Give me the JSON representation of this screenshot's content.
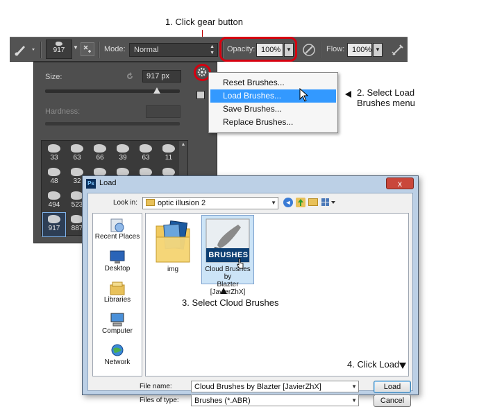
{
  "annotations": {
    "step1": "1. Click gear button",
    "step2_line1": "2. Select Load",
    "step2_line2": "Brushes menu",
    "step3": "3. Select Cloud Brushes",
    "step4": "4. Click Load"
  },
  "toolbar": {
    "brush_size": "917",
    "mode_label": "Mode:",
    "mode_value": "Normal",
    "opacity_label": "Opacity:",
    "opacity_value": "100%",
    "flow_label": "Flow:",
    "flow_value": "100%"
  },
  "brush_panel": {
    "size_label": "Size:",
    "size_value": "917 px",
    "size_level_pct": 83,
    "hardness_label": "Hardness:",
    "brushes": [
      {
        "num": "33"
      },
      {
        "num": "63"
      },
      {
        "num": "66"
      },
      {
        "num": "39"
      },
      {
        "num": "63"
      },
      {
        "num": "11"
      },
      {
        "num": "48"
      },
      {
        "num": "32"
      },
      {
        "num": ""
      },
      {
        "num": ""
      },
      {
        "num": ""
      },
      {
        "num": ""
      },
      {
        "num": "494"
      },
      {
        "num": "523"
      },
      {
        "num": ""
      },
      {
        "num": ""
      },
      {
        "num": ""
      },
      {
        "num": ""
      },
      {
        "num": "917"
      },
      {
        "num": "887"
      },
      {
        "num": ""
      },
      {
        "num": ""
      },
      {
        "num": ""
      },
      {
        "num": ""
      }
    ]
  },
  "menu": {
    "items": [
      "Reset Brushes...",
      "Load Brushes...",
      "Save Brushes...",
      "Replace Brushes..."
    ],
    "highlighted_index": 1,
    "highlight_color": "#3399ff"
  },
  "dialog": {
    "app_icon": "Ps",
    "title": "Load",
    "close": "x",
    "look_in_label": "Look in:",
    "look_in_value": "optic illusion 2",
    "places": [
      "Recent Places",
      "Desktop",
      "Libraries",
      "Computer",
      "Network"
    ],
    "files": [
      {
        "name": "img"
      },
      {
        "name_line1": "Cloud Brushes by",
        "name_line2": "Blazter [JavierZhX]",
        "badge": "BRUSHES"
      }
    ],
    "file_name_label": "File name:",
    "file_name_value": "Cloud Brushes by Blazter [JavierZhX]",
    "file_type_label": "Files of type:",
    "file_type_value": "Brushes (*.ABR)",
    "load_button": "Load",
    "cancel_button": "Cancel"
  },
  "colors": {
    "annotation_red": "#d6000f",
    "toolbar_bg": "#535353",
    "panel_bg": "#4e4e4e",
    "dialog_frame": "#bcd0e6"
  }
}
